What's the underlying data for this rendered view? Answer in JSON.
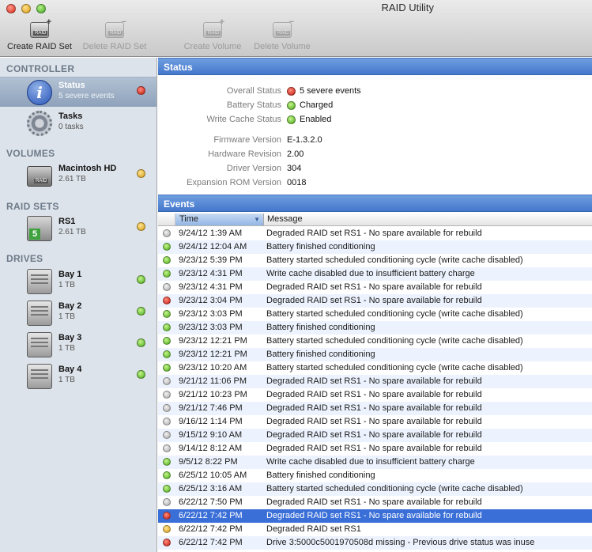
{
  "window": {
    "title": "RAID Utility"
  },
  "toolbar": [
    {
      "label": "Create RAID Set",
      "enabled": true,
      "icon": "create-raid-set-icon"
    },
    {
      "label": "Delete RAID Set",
      "enabled": false,
      "icon": "delete-raid-set-icon"
    },
    {
      "label": "Create Volume",
      "enabled": false,
      "icon": "create-volume-icon"
    },
    {
      "label": "Delete Volume",
      "enabled": false,
      "icon": "delete-volume-icon"
    }
  ],
  "sidebar": {
    "sections": {
      "controller": "CONTROLLER",
      "volumes": "VOLUMES",
      "raid_sets": "RAID SETS",
      "drives": "DRIVES"
    },
    "controller": [
      {
        "name": "Status",
        "sub": "5 severe events",
        "status": "red",
        "selected": true,
        "icon": "info-icon"
      },
      {
        "name": "Tasks",
        "sub": "0 tasks",
        "status": "",
        "selected": false,
        "icon": "gear-icon"
      }
    ],
    "volumes": [
      {
        "name": "Macintosh HD",
        "sub": "2.61 TB",
        "status": "yellow",
        "icon": "raid-disk-icon"
      }
    ],
    "raid_sets": [
      {
        "name": "RS1",
        "sub": "2.61 TB",
        "status": "yellow",
        "icon": "raid5-set-icon"
      }
    ],
    "drives": [
      {
        "name": "Bay 1",
        "sub": "1 TB",
        "status": "green",
        "icon": "drive-icon"
      },
      {
        "name": "Bay 2",
        "sub": "1 TB",
        "status": "green",
        "icon": "drive-icon"
      },
      {
        "name": "Bay 3",
        "sub": "1 TB",
        "status": "green",
        "icon": "drive-icon"
      },
      {
        "name": "Bay 4",
        "sub": "1 TB",
        "status": "green",
        "icon": "drive-icon"
      }
    ]
  },
  "status_panel": {
    "title": "Status",
    "overall": {
      "label": "Overall Status",
      "value": "5 severe events",
      "status": "red"
    },
    "battery": {
      "label": "Battery Status",
      "value": "Charged",
      "status": "green"
    },
    "write_cache": {
      "label": "Write Cache Status",
      "value": "Enabled",
      "status": "green"
    },
    "firmware": {
      "label": "Firmware Version",
      "value": "E-1.3.2.0"
    },
    "hardware": {
      "label": "Hardware Revision",
      "value": "2.00"
    },
    "driver": {
      "label": "Driver Version",
      "value": "304"
    },
    "rom": {
      "label": "Expansion ROM Version",
      "value": "0018"
    }
  },
  "events_panel": {
    "title": "Events",
    "columns": {
      "time": "Time",
      "message": "Message"
    },
    "rows": [
      {
        "status": "gray",
        "time": "9/24/12 1:39 AM",
        "message": "Degraded RAID set RS1 - No spare available for rebuild"
      },
      {
        "status": "green",
        "time": "9/24/12 12:04 AM",
        "message": "Battery finished conditioning"
      },
      {
        "status": "green",
        "time": "9/23/12 5:39 PM",
        "message": "Battery started scheduled conditioning cycle (write cache disabled)"
      },
      {
        "status": "green",
        "time": "9/23/12 4:31 PM",
        "message": "Write cache disabled due to insufficient battery charge"
      },
      {
        "status": "gray",
        "time": "9/23/12 4:31 PM",
        "message": "Degraded RAID set RS1 - No spare available for rebuild"
      },
      {
        "status": "red",
        "time": "9/23/12 3:04 PM",
        "message": "Degraded RAID set RS1 - No spare available for rebuild"
      },
      {
        "status": "green",
        "time": "9/23/12 3:03 PM",
        "message": "Battery started scheduled conditioning cycle (write cache disabled)"
      },
      {
        "status": "green",
        "time": "9/23/12 3:03 PM",
        "message": "Battery finished conditioning"
      },
      {
        "status": "green",
        "time": "9/23/12 12:21 PM",
        "message": "Battery started scheduled conditioning cycle (write cache disabled)"
      },
      {
        "status": "green",
        "time": "9/23/12 12:21 PM",
        "message": "Battery finished conditioning"
      },
      {
        "status": "green",
        "time": "9/23/12 10:20 AM",
        "message": "Battery started scheduled conditioning cycle (write cache disabled)"
      },
      {
        "status": "gray",
        "time": "9/21/12 11:06 PM",
        "message": "Degraded RAID set RS1 - No spare available for rebuild"
      },
      {
        "status": "gray",
        "time": "9/21/12 10:23 PM",
        "message": "Degraded RAID set RS1 - No spare available for rebuild"
      },
      {
        "status": "gray",
        "time": "9/21/12 7:46 PM",
        "message": "Degraded RAID set RS1 - No spare available for rebuild"
      },
      {
        "status": "gray",
        "time": "9/16/12 1:14 PM",
        "message": "Degraded RAID set RS1 - No spare available for rebuild"
      },
      {
        "status": "gray",
        "time": "9/15/12 9:10 AM",
        "message": "Degraded RAID set RS1 - No spare available for rebuild"
      },
      {
        "status": "gray",
        "time": "9/14/12 8:12 AM",
        "message": "Degraded RAID set RS1 - No spare available for rebuild"
      },
      {
        "status": "green",
        "time": "9/5/12 8:22 PM",
        "message": "Write cache disabled due to insufficient battery charge"
      },
      {
        "status": "green",
        "time": "6/25/12 10:05 AM",
        "message": "Battery finished conditioning"
      },
      {
        "status": "green",
        "time": "6/25/12 3:16 AM",
        "message": "Battery started scheduled conditioning cycle (write cache disabled)"
      },
      {
        "status": "gray",
        "time": "6/22/12 7:50 PM",
        "message": "Degraded RAID set RS1 - No spare available for rebuild"
      },
      {
        "status": "red",
        "time": "6/22/12 7:42 PM",
        "message": "Degraded RAID set RS1 - No spare available for rebuild",
        "selected": true
      },
      {
        "status": "yellow",
        "time": "6/22/12 7:42 PM",
        "message": "Degraded RAID set RS1"
      },
      {
        "status": "red",
        "time": "6/22/12 7:42 PM",
        "message": "Drive 3:5000c5001970508d missing - Previous drive status was inuse"
      }
    ]
  }
}
